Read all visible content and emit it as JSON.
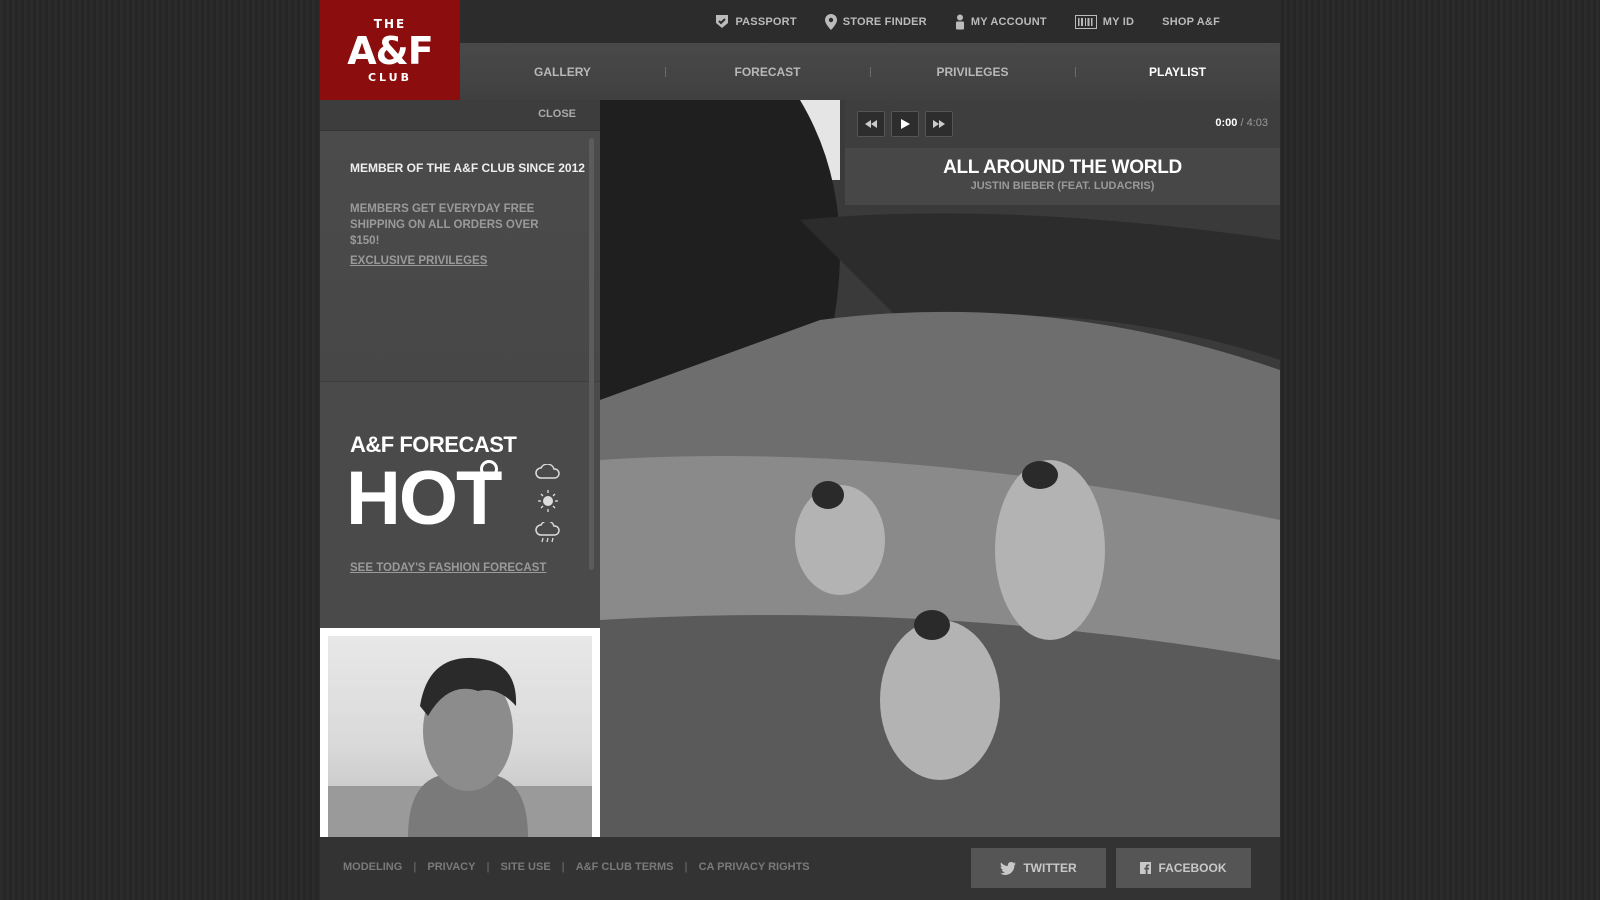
{
  "logo": {
    "the": "THE",
    "brand": "A&F",
    "club": "CLUB"
  },
  "util_nav": [
    {
      "label": "PASSPORT",
      "icon": "check-shield-icon"
    },
    {
      "label": "STORE FINDER",
      "icon": "map-pin-icon"
    },
    {
      "label": "MY ACCOUNT",
      "icon": "person-icon"
    },
    {
      "label": "MY ID",
      "icon": "barcode-icon"
    },
    {
      "label": "SHOP A&F",
      "icon": ""
    }
  ],
  "main_nav": [
    {
      "label": "GALLERY",
      "active": false
    },
    {
      "label": "FORECAST",
      "active": false
    },
    {
      "label": "PRIVILEGES",
      "active": false
    },
    {
      "label": "PLAYLIST",
      "active": true
    }
  ],
  "sidebar": {
    "close_label": "CLOSE",
    "member_since": "MEMBER OF THE A&F CLUB SINCE 2012",
    "shipping_note": "MEMBERS GET EVERYDAY FREE SHIPPING ON ALL ORDERS OVER $150!",
    "privileges_link": "EXCLUSIVE PRIVILEGES",
    "forecast_title": "A&F FORECAST",
    "forecast_value": "HOT",
    "forecast_link": "SEE TODAY'S FASHION FORECAST",
    "weather_icons": [
      "cloud-icon",
      "sun-icon",
      "rain-cloud-icon"
    ]
  },
  "player": {
    "current_time": "0:00",
    "separator": " / ",
    "total_time": "4:03",
    "progress": 0,
    "track_title": "ALL AROUND THE WORLD",
    "track_artist": "JUSTIN BIEBER (FEAT. LUDACRIS)"
  },
  "footer": {
    "links": [
      "MODELING",
      "PRIVACY",
      "SITE USE",
      "A&F CLUB TERMS",
      "CA PRIVACY RIGHTS"
    ],
    "twitter_label": "TWITTER",
    "facebook_label": "FACEBOOK"
  },
  "colors": {
    "brand_red": "#8b0d0d",
    "dark_bg": "#2b2b2b",
    "panel": "#4a4a4a"
  }
}
